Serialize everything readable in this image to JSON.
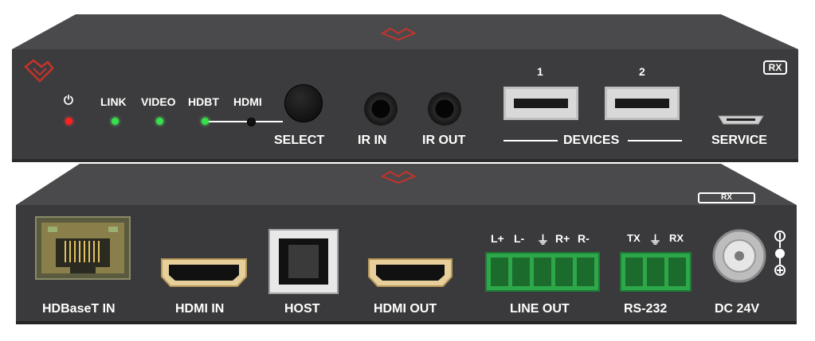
{
  "front_panel": {
    "rx_badge": "RX",
    "leds": [
      {
        "label": "",
        "icon": "power-icon",
        "color": "#ff2020"
      },
      {
        "label": "LINK",
        "color": "#35e04a"
      },
      {
        "label": "VIDEO",
        "color": "#35e04a"
      },
      {
        "label": "HDBT",
        "color": "#35e04a"
      },
      {
        "label": "HDMI",
        "color": "#111111"
      }
    ],
    "select_label": "SELECT",
    "ir_in_label": "IR IN",
    "ir_out_label": "IR OUT",
    "device_numbers": [
      "1",
      "2"
    ],
    "devices_label": "DEVICES",
    "service_label": "SERVICE"
  },
  "rear_panel": {
    "rx_badge": "RX",
    "hdbaset_label": "HDBaseT IN",
    "hdmi_in_label": "HDMI IN",
    "host_label": "HOST",
    "hdmi_out_label": "HDMI OUT",
    "line_out_pins": [
      "L+",
      "L-",
      "⏚",
      "R+",
      "R-"
    ],
    "line_out_label": "LINE OUT",
    "rs232_pins": [
      "TX",
      "⏚",
      "RX"
    ],
    "rs232_label": "RS-232",
    "dc_label": "DC 24V"
  },
  "colors": {
    "chassis": "#3c3c3e",
    "chassis_top": "#4a4a4c",
    "brand_accent": "#c8322a",
    "terminal_green": "#2ea74a"
  }
}
